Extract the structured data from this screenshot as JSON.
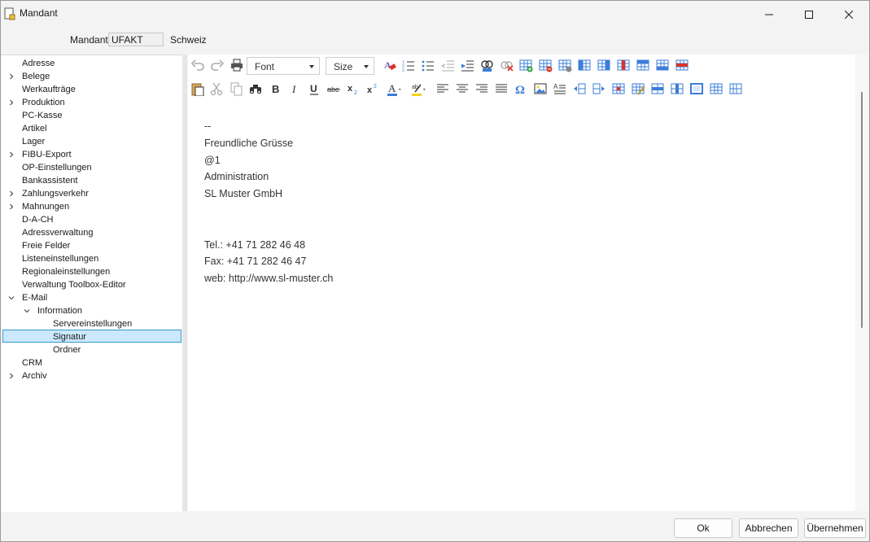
{
  "window": {
    "title": "Mandant"
  },
  "header": {
    "mandant_label": "Mandant",
    "mandant_value": "UFAKT",
    "country": "Schweiz"
  },
  "tree": {
    "items": [
      {
        "label": "Adresse",
        "expandable": false,
        "expanded": false,
        "level": 0,
        "selected": false
      },
      {
        "label": "Belege",
        "expandable": true,
        "expanded": false,
        "level": 0,
        "selected": false
      },
      {
        "label": "Werkaufträge",
        "expandable": false,
        "expanded": false,
        "level": 0,
        "selected": false
      },
      {
        "label": "Produktion",
        "expandable": true,
        "expanded": false,
        "level": 0,
        "selected": false
      },
      {
        "label": "PC-Kasse",
        "expandable": false,
        "expanded": false,
        "level": 0,
        "selected": false
      },
      {
        "label": "Artikel",
        "expandable": false,
        "expanded": false,
        "level": 0,
        "selected": false
      },
      {
        "label": "Lager",
        "expandable": false,
        "expanded": false,
        "level": 0,
        "selected": false
      },
      {
        "label": "FIBU-Export",
        "expandable": true,
        "expanded": false,
        "level": 0,
        "selected": false
      },
      {
        "label": "OP-Einstellungen",
        "expandable": false,
        "expanded": false,
        "level": 0,
        "selected": false
      },
      {
        "label": "Bankassistent",
        "expandable": false,
        "expanded": false,
        "level": 0,
        "selected": false
      },
      {
        "label": "Zahlungsverkehr",
        "expandable": true,
        "expanded": false,
        "level": 0,
        "selected": false
      },
      {
        "label": "Mahnungen",
        "expandable": true,
        "expanded": false,
        "level": 0,
        "selected": false
      },
      {
        "label": "D-A-CH",
        "expandable": false,
        "expanded": false,
        "level": 0,
        "selected": false
      },
      {
        "label": "Adressverwaltung",
        "expandable": false,
        "expanded": false,
        "level": 0,
        "selected": false
      },
      {
        "label": "Freie Felder",
        "expandable": false,
        "expanded": false,
        "level": 0,
        "selected": false
      },
      {
        "label": "Listeneinstellungen",
        "expandable": false,
        "expanded": false,
        "level": 0,
        "selected": false
      },
      {
        "label": "Regionaleinstellungen",
        "expandable": false,
        "expanded": false,
        "level": 0,
        "selected": false
      },
      {
        "label": "Verwaltung Toolbox-Editor",
        "expandable": false,
        "expanded": false,
        "level": 0,
        "selected": false
      },
      {
        "label": "E-Mail",
        "expandable": true,
        "expanded": true,
        "level": 0,
        "selected": false
      },
      {
        "label": "Information",
        "expandable": true,
        "expanded": true,
        "level": 1,
        "selected": false
      },
      {
        "label": "Servereinstellungen",
        "expandable": false,
        "expanded": false,
        "level": 2,
        "selected": false
      },
      {
        "label": "Signatur",
        "expandable": false,
        "expanded": false,
        "level": 2,
        "selected": true
      },
      {
        "label": "Ordner",
        "expandable": false,
        "expanded": false,
        "level": 2,
        "selected": false
      },
      {
        "label": "CRM",
        "expandable": false,
        "expanded": false,
        "level": 0,
        "selected": false
      },
      {
        "label": "Archiv",
        "expandable": true,
        "expanded": false,
        "level": 0,
        "selected": false
      }
    ]
  },
  "toolbar": {
    "font_label": "Font",
    "size_label": "Size",
    "row1_icons": [
      "undo-icon",
      "redo-icon",
      "print-icon",
      "font-dropdown",
      "size-dropdown",
      "clear-format-icon",
      "numbered-list-icon",
      "bullet-list-icon",
      "outdent-icon",
      "indent-icon",
      "insert-link-icon",
      "remove-link-icon",
      "insert-table-icon",
      "delete-table-icon",
      "table-properties-icon",
      "insert-column-left-icon",
      "insert-column-right-icon",
      "delete-column-icon",
      "insert-row-above-icon",
      "insert-row-below-icon",
      "delete-row-icon"
    ],
    "row2_icons": [
      "paste-icon",
      "cut-icon",
      "copy-icon",
      "find-icon",
      "bold-icon",
      "italic-icon",
      "underline-icon",
      "strikethrough-icon",
      "subscript-icon",
      "superscript-icon",
      "font-color-icon",
      "highlight-color-icon",
      "align-left-icon",
      "align-center-icon",
      "align-right-icon",
      "justify-icon",
      "special-character-icon",
      "insert-image-icon",
      "paragraph-icon",
      "split-cell-left-icon",
      "split-cell-right-icon",
      "cell-properties-icon",
      "edit-cell-icon",
      "merge-cells-icon",
      "split-cells-icon",
      "table-border-icon",
      "table-grid-icon",
      "table-columns-icon"
    ],
    "colors": {
      "blue": "#3b7dd8",
      "red": "#d9342b",
      "green": "#2e9c3a",
      "yellow": "#f2d21b",
      "gray": "#6b6b6b"
    }
  },
  "editor": {
    "lines": [
      "--",
      "Freundliche Grüsse",
      "@1",
      "Administration",
      "SL Muster GmbH",
      "",
      "",
      "Tel.: +41 71 282 46 48",
      "Fax: +41 71 282 46 47",
      "web: http://www.sl-muster.ch"
    ]
  },
  "buttons": {
    "ok": "Ok",
    "cancel": "Abbrechen",
    "apply": "Übernehmen"
  }
}
